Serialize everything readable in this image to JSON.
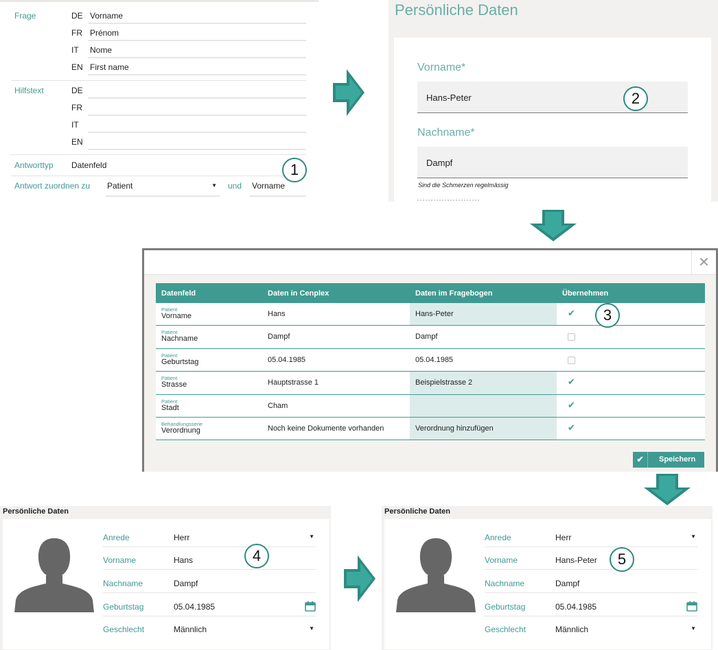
{
  "panel1": {
    "frage_label": "Frage",
    "frage": [
      {
        "lang": "DE",
        "value": "Vorname"
      },
      {
        "lang": "FR",
        "value": "Prénom"
      },
      {
        "lang": "IT",
        "value": "Nome"
      },
      {
        "lang": "EN",
        "value": "First name"
      }
    ],
    "hilfstext_label": "Hilfstext",
    "hilfstext": [
      {
        "lang": "DE",
        "value": ""
      },
      {
        "lang": "FR",
        "value": ""
      },
      {
        "lang": "IT",
        "value": ""
      },
      {
        "lang": "EN",
        "value": ""
      }
    ],
    "antworttyp_label": "Antworttyp",
    "antworttyp_value": "Datenfeld",
    "zuordnen_label": "Antwort zuordnen zu",
    "zuordnen_value": "Patient",
    "und_label": "und",
    "und_value": "Vorname"
  },
  "panel2": {
    "title": "Persönliche Daten",
    "vorname_label": "Vorname*",
    "vorname_value": "Hans-Peter",
    "nachname_label": "Nachname*",
    "nachname_value": "Dampf",
    "hint": "Sind die Schmerzen regelmässig"
  },
  "markers": [
    "1",
    "2",
    "3",
    "4",
    "5"
  ],
  "dialog": {
    "close_label": "✕",
    "columns": [
      "Datenfeld",
      "Daten in Cenplex",
      "Daten im Fragebogen",
      "Übernehmen"
    ],
    "rows": [
      {
        "category": "Patient",
        "field": "Vorname",
        "cenplex": "Hans",
        "fragebogen": "Hans-Peter",
        "highlight": true,
        "checked": true
      },
      {
        "category": "Patient",
        "field": "Nachname",
        "cenplex": "Dampf",
        "fragebogen": "Dampf",
        "highlight": false,
        "checked": false
      },
      {
        "category": "Patient",
        "field": "Geburtstag",
        "cenplex": "05.04.1985",
        "fragebogen": "05.04.1985",
        "highlight": false,
        "checked": false
      },
      {
        "category": "Patient",
        "field": "Strasse",
        "cenplex": "Hauptstrasse 1",
        "fragebogen": "Beispielstrasse 2",
        "highlight": true,
        "checked": true
      },
      {
        "category": "Patient",
        "field": "Stadt",
        "cenplex": "Cham",
        "fragebogen": "",
        "highlight": true,
        "checked": true
      },
      {
        "category": "Behandlungsserie",
        "field": "Verordnung",
        "cenplex": "Noch keine Dokumente vorhanden",
        "fragebogen": "Verordnung hinzufügen",
        "highlight": true,
        "checked": true
      }
    ],
    "save_label": "Speichern"
  },
  "before": {
    "title": "Persönliche Daten",
    "fields": [
      {
        "label": "Anrede",
        "value": "Herr"
      },
      {
        "label": "Vorname",
        "value": "Hans"
      },
      {
        "label": "Nachname",
        "value": "Dampf"
      },
      {
        "label": "Geburtstag",
        "value": "05.04.1985"
      },
      {
        "label": "Geschlecht",
        "value": "Männlich"
      }
    ]
  },
  "after": {
    "title": "Persönliche Daten",
    "fields": [
      {
        "label": "Anrede",
        "value": "Herr"
      },
      {
        "label": "Vorname",
        "value": "Hans-Peter"
      },
      {
        "label": "Nachname",
        "value": "Dampf"
      },
      {
        "label": "Geburtstag",
        "value": "05.04.1985"
      },
      {
        "label": "Geschlecht",
        "value": "Männlich"
      }
    ]
  },
  "colors": {
    "accent": "#3f9a92",
    "arrow": "#2e8a80",
    "highlight": "#dcecea",
    "panel_bg": "#f2f1ef"
  },
  "icons": [
    "arrow-right-icon",
    "arrow-down-icon",
    "check-icon",
    "close-icon",
    "calendar-icon",
    "chevron-down-icon",
    "avatar-silhouette-icon"
  ]
}
